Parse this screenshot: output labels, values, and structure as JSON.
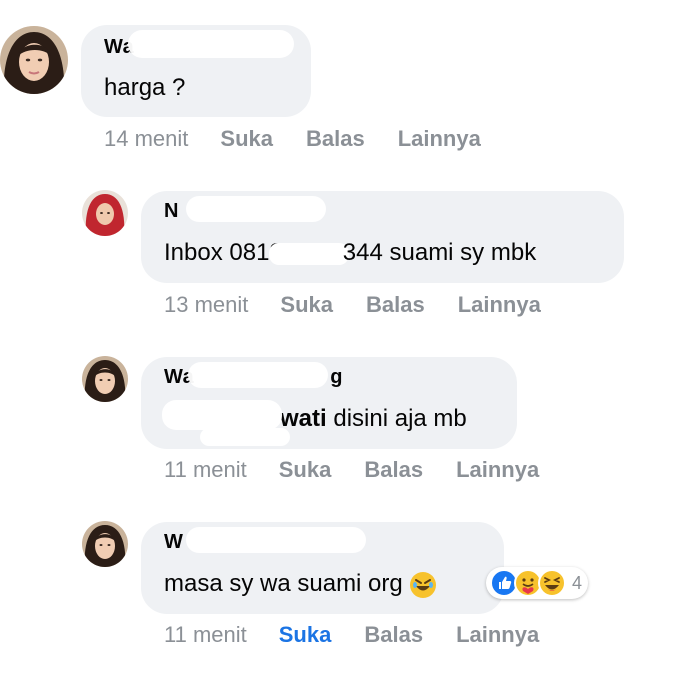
{
  "comments": [
    {
      "name": "Wa",
      "text": "harga ?",
      "time": "14 menit",
      "like": "Suka",
      "reply": "Balas",
      "more": "Lainnya"
    },
    {
      "name": "N",
      "text_start": "Inbox 0812",
      "text_end": "344 suami sy mbk",
      "time": "13 menit",
      "like": "Suka",
      "reply": "Balas",
      "more": "Lainnya"
    },
    {
      "name_start": "Wa",
      "name_end": "g",
      "mention_end": "wati",
      "text": " disini aja mb",
      "time": "11 menit",
      "like": "Suka",
      "reply": "Balas",
      "more": "Lainnya"
    },
    {
      "name": "W",
      "text": "masa sy wa suami org",
      "reaction_count": "4",
      "time": "11 menit",
      "like": "Suka",
      "reply": "Balas",
      "more": "Lainnya"
    }
  ],
  "colors": {
    "bubble": "#eff1f4",
    "meta_text": "#8b9096",
    "liked": "#1b74e4",
    "like_reaction": "#1877f2",
    "haha_reaction": "#f7c22c"
  },
  "icons": {
    "inline_emoji": "rolling-on-floor-laughing-emoji",
    "reactions": [
      "like-reaction-icon",
      "care-reaction-icon",
      "haha-reaction-icon"
    ]
  }
}
